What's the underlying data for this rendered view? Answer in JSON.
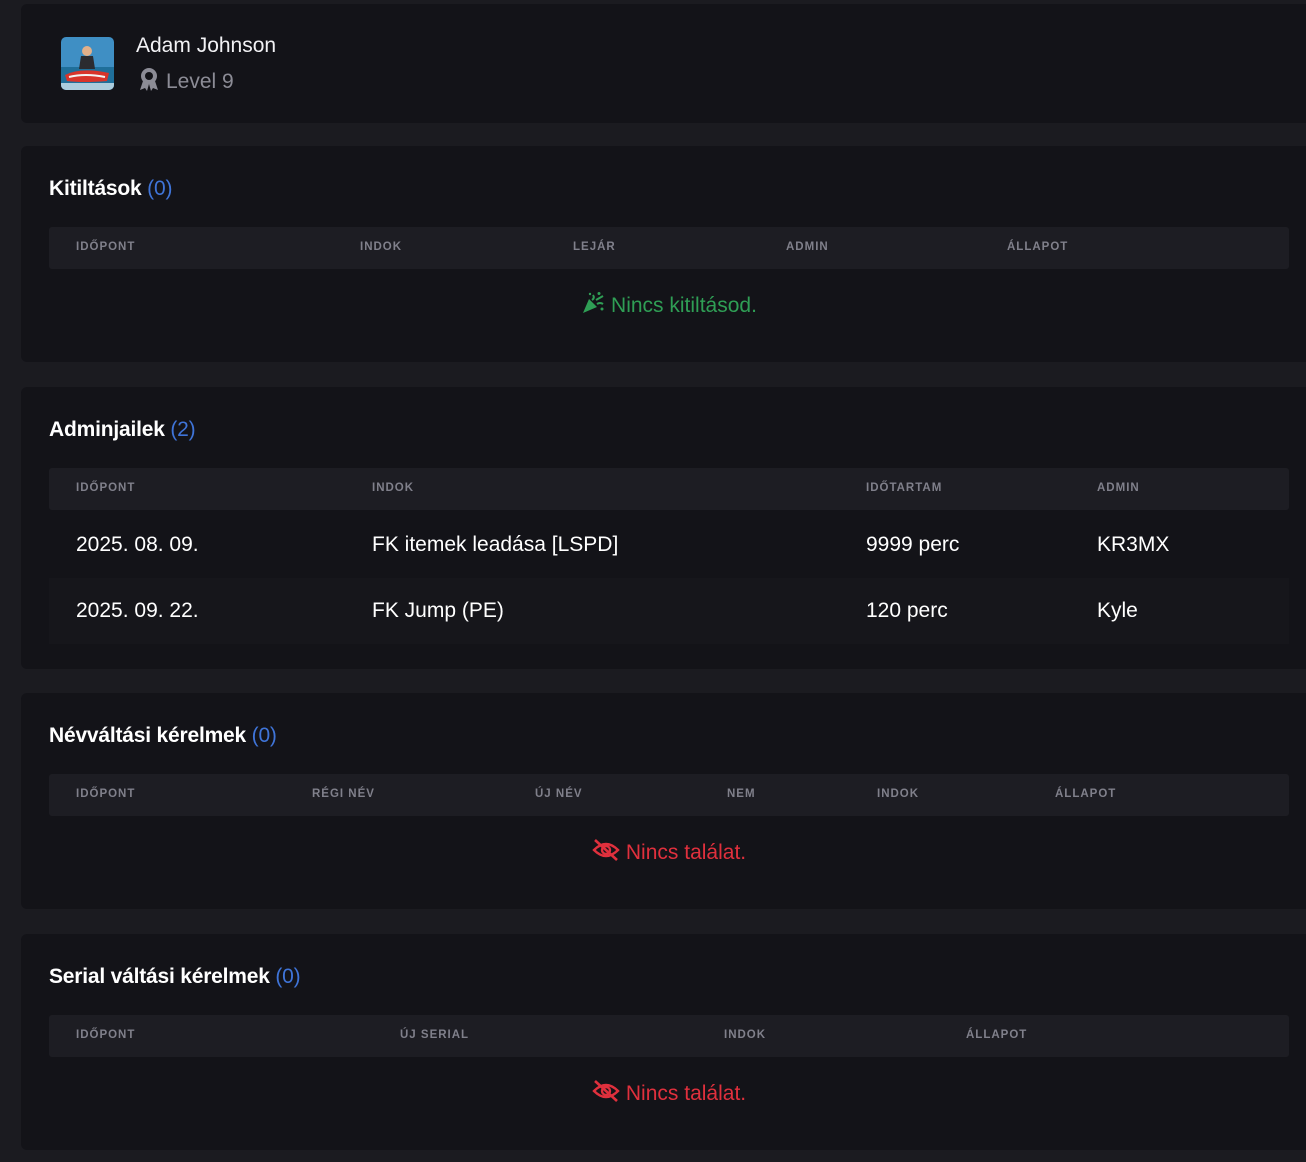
{
  "profile": {
    "name": "Adam Johnson",
    "level": "Level 9",
    "avatar_icon": "avatar-image",
    "level_icon": "award-ribbon-icon"
  },
  "bans": {
    "title": "Kitiltások",
    "count": "(0)",
    "columns": [
      "IDŐPONT",
      "INDOK",
      "LEJÁR",
      "ADMIN",
      "ÁLLAPOT"
    ],
    "empty_text": "Nincs kitiltásod.",
    "empty_icon": "party-popper-icon",
    "empty_color": "#2f9e55"
  },
  "adminjails": {
    "title": "Adminjailek",
    "count": "(2)",
    "columns": [
      "IDŐPONT",
      "INDOK",
      "IDŐTARTAM",
      "ADMIN"
    ],
    "rows": [
      [
        "2025. 08. 09.",
        "FK itemek leadása [LSPD]",
        "9999 perc",
        "KR3MX"
      ],
      [
        "2025. 09. 22.",
        "FK Jump (PE)",
        "120 perc",
        "Kyle"
      ]
    ]
  },
  "namechanges": {
    "title": "Névváltási kérelmek",
    "count": "(0)",
    "columns": [
      "IDŐPONT",
      "RÉGI NÉV",
      "ÚJ NÉV",
      "NEM",
      "INDOK",
      "ÁLLAPOT"
    ],
    "empty_text": "Nincs találat.",
    "empty_icon": "eye-slash-icon",
    "empty_color": "#e0303d"
  },
  "serialchanges": {
    "title": "Serial váltási kérelmek",
    "count": "(0)",
    "columns": [
      "IDŐPONT",
      "ÚJ SERIAL",
      "INDOK",
      "ÁLLAPOT"
    ],
    "empty_text": "Nincs találat.",
    "empty_icon": "eye-slash-icon",
    "empty_color": "#e0303d"
  },
  "colors": {
    "accent_count": "#3f74d8",
    "background": "#1b1b20",
    "card": "#131318"
  }
}
